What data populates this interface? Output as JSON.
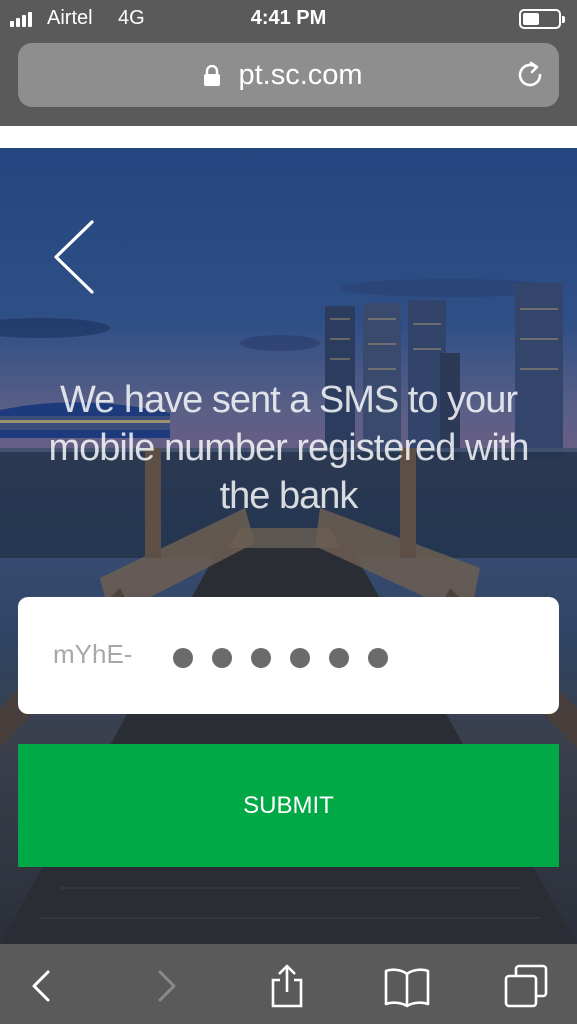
{
  "status_bar": {
    "carrier": "Airtel",
    "network": "4G",
    "time": "4:41 PM",
    "icons": [
      "signal-icon",
      "battery-icon"
    ]
  },
  "browser": {
    "url": "pt.sc.com",
    "icons": [
      "lock-icon",
      "reload-icon"
    ]
  },
  "page": {
    "message": "We have sent a SMS to your mobile number registered with the bank",
    "code_prefix": "mYhE-",
    "code_digits_masked": 6,
    "submit_label": "SUBMIT",
    "accent_color": "#00a846"
  },
  "toolbar": {
    "items": [
      "back-icon",
      "forward-icon",
      "share-icon",
      "bookmarks-icon",
      "tabs-icon"
    ]
  }
}
